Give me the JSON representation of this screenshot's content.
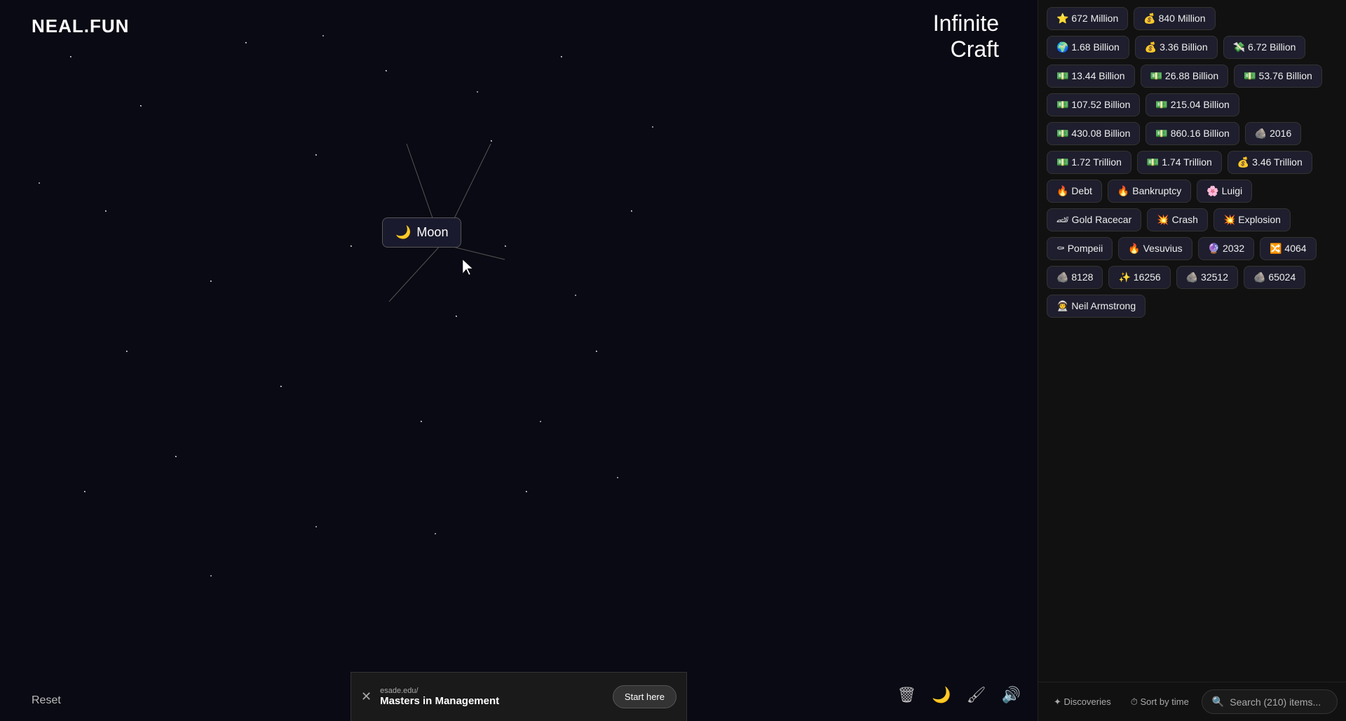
{
  "logo": {
    "text": "NEAL.FUN"
  },
  "gameTitle": {
    "line1": "Infinite",
    "line2": "Craft"
  },
  "canvas": {
    "moonElement": {
      "emoji": "🌙",
      "label": "Moon"
    }
  },
  "toolbar": {
    "resetLabel": "Reset",
    "deleteIcon": "🗑",
    "nightIcon": "🌙",
    "brushIcon": "🖌",
    "soundIcon": "🔊"
  },
  "ad": {
    "closeIcon": "✕",
    "domain": "esade.edu/",
    "title": "Masters in Management",
    "cta": "Start here"
  },
  "sidebar": {
    "items": [
      {
        "emoji": "🌍",
        "label": "1.68 Billion"
      },
      {
        "emoji": "💰",
        "label": "3.36 Billion"
      },
      {
        "emoji": "💸",
        "label": "6.72 Billion"
      },
      {
        "emoji": "💵",
        "label": "13.44 Billion"
      },
      {
        "emoji": "💵",
        "label": "26.88 Billion"
      },
      {
        "emoji": "💵",
        "label": "53.76 Billion"
      },
      {
        "emoji": "💵",
        "label": "107.52 Billion"
      },
      {
        "emoji": "💵",
        "label": "215.04 Billion"
      },
      {
        "emoji": "💵",
        "label": "430.08 Billion"
      },
      {
        "emoji": "💵",
        "label": "860.16 Billion"
      },
      {
        "emoji": "🪨",
        "label": "2016"
      },
      {
        "emoji": "💵",
        "label": "1.72 Trillion"
      },
      {
        "emoji": "💵",
        "label": "1.74 Trillion"
      },
      {
        "emoji": "💰",
        "label": "3.46 Trillion"
      },
      {
        "emoji": "🔥",
        "label": "Debt"
      },
      {
        "emoji": "🔥",
        "label": "Bankruptcy"
      },
      {
        "emoji": "🌸",
        "label": "Luigi"
      },
      {
        "emoji": "🏎",
        "label": "Gold Racecar"
      },
      {
        "emoji": "💥",
        "label": "Crash"
      },
      {
        "emoji": "💥",
        "label": "Explosion"
      },
      {
        "emoji": "⚰",
        "label": "Pompeii"
      },
      {
        "emoji": "🔥",
        "label": "Vesuvius"
      },
      {
        "emoji": "🔮",
        "label": "2032"
      },
      {
        "emoji": "🔀",
        "label": "4064"
      },
      {
        "emoji": "🪨",
        "label": "8128"
      },
      {
        "emoji": "✨",
        "label": "16256"
      },
      {
        "emoji": "🪨",
        "label": "32512"
      },
      {
        "emoji": "🪨",
        "label": "65024"
      },
      {
        "emoji": "👨‍🚀",
        "label": "Neil Armstrong"
      }
    ],
    "topItems": [
      {
        "emoji": "⭐",
        "label": "672 Million"
      },
      {
        "emoji": "💰",
        "label": "840 Million"
      }
    ],
    "footer": {
      "discoveriesLabel": "✦ Discoveries",
      "sortLabel": "⏱ Sort by time",
      "searchPlaceholder": "Search (210) items..."
    }
  }
}
